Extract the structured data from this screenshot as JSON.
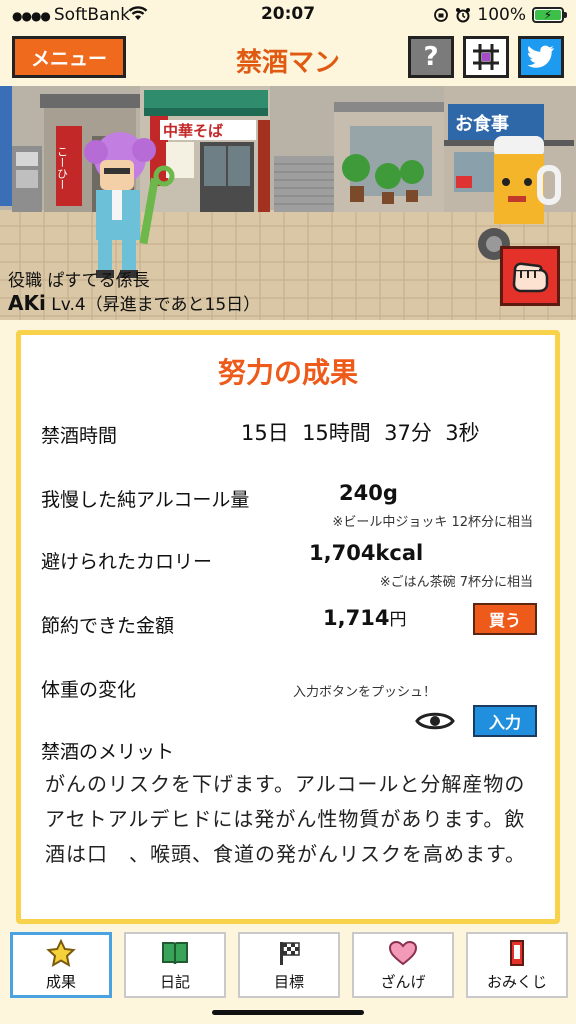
{
  "status_bar": {
    "carrier": "SoftBank",
    "time": "20:07",
    "battery": "100%"
  },
  "header": {
    "menu_label": "メニュー",
    "title": "禁酒マン",
    "help_label": "?"
  },
  "scene": {
    "role": "役職 ぱすてる係長",
    "name": "AKi",
    "level": "Lv.4（昇進まであと15日）",
    "signs": {
      "left": "こーひー",
      "noodle": "中華そば",
      "restaurant": "お食事"
    }
  },
  "card": {
    "title": "努力の成果",
    "abstinence": {
      "label": "禁酒時間",
      "value": "15日  15時間  37分  3秒"
    },
    "alcohol": {
      "label": "我慢した純アルコール量",
      "value": "240g",
      "note": "※ビール中ジョッキ 12杯分に相当"
    },
    "calories": {
      "label": "避けられたカロリー",
      "value": "1,704kcal",
      "note": "※ごはん茶碗 7杯分に相当"
    },
    "money": {
      "label": "節約できた金額",
      "value": "1,714",
      "unit": "円",
      "buy_label": "買う"
    },
    "weight": {
      "label": "体重の変化",
      "hint": "入力ボタンをプッシュ！",
      "input_label": "入力"
    },
    "merit": {
      "title": "禁酒のメリット",
      "body": "がんのリスクを下げます。アルコールと分解産物のアセトアルデヒドには発がん性物質があります。飲酒は口　、喉頭、食道の発がんリスクを高めます。"
    }
  },
  "tabs": [
    {
      "label": "成果",
      "icon": "star-icon",
      "active": true
    },
    {
      "label": "日記",
      "icon": "book-icon",
      "active": false
    },
    {
      "label": "目標",
      "icon": "flag-icon",
      "active": false
    },
    {
      "label": "ざんげ",
      "icon": "heart-icon",
      "active": false
    },
    {
      "label": "おみくじ",
      "icon": "omikuji-icon",
      "active": false
    }
  ],
  "colors": {
    "accent": "#ee5a1a",
    "card_border": "#f7d24a",
    "button_blue": "#1f8fde",
    "background": "#fdf6dd"
  }
}
